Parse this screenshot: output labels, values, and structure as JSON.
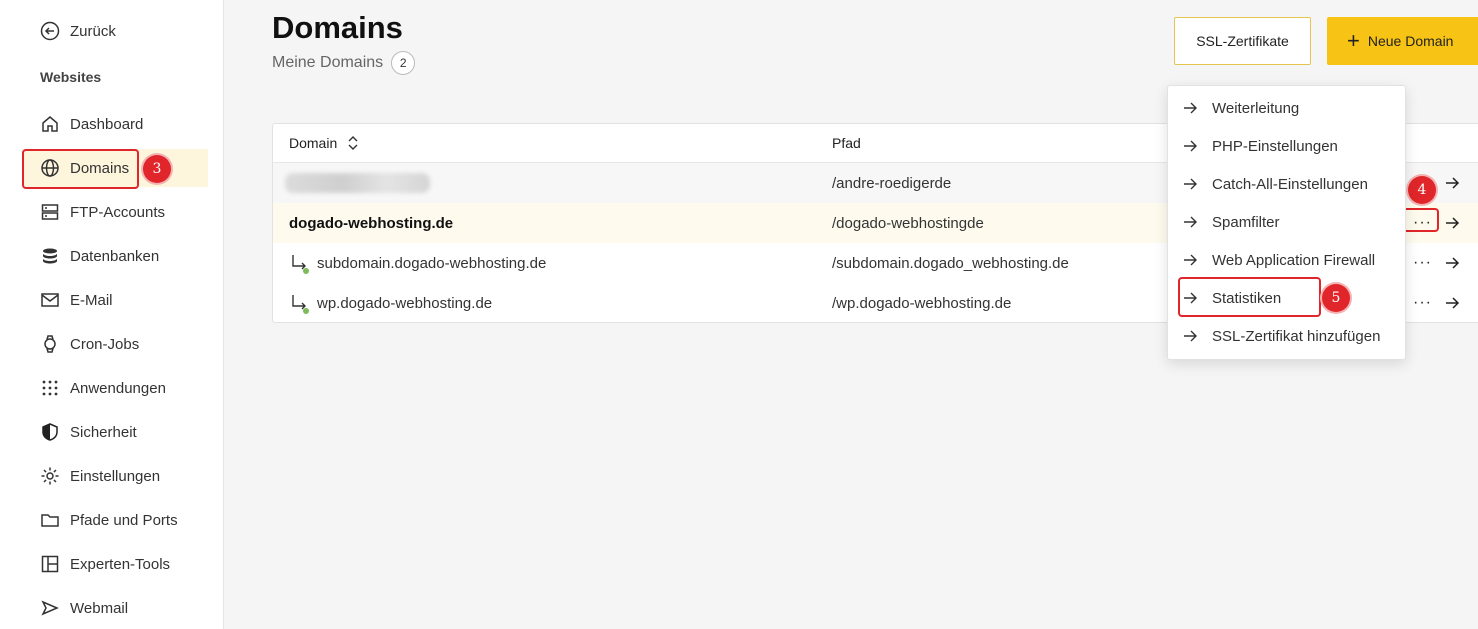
{
  "sidebar": {
    "back_label": "Zurück",
    "section_label": "Websites",
    "items": [
      {
        "label": "Dashboard",
        "icon": "home-icon"
      },
      {
        "label": "Domains",
        "icon": "globe-icon"
      },
      {
        "label": "FTP-Accounts",
        "icon": "server-icon"
      },
      {
        "label": "Datenbanken",
        "icon": "database-icon"
      },
      {
        "label": "E-Mail",
        "icon": "mail-icon"
      },
      {
        "label": "Cron-Jobs",
        "icon": "watch-icon"
      },
      {
        "label": "Anwendungen",
        "icon": "grid-dots-icon"
      },
      {
        "label": "Sicherheit",
        "icon": "shield-icon"
      },
      {
        "label": "Einstellungen",
        "icon": "gear-icon"
      },
      {
        "label": "Pfade und Ports",
        "icon": "folder-icon"
      },
      {
        "label": "Experten-Tools",
        "icon": "layout-icon"
      },
      {
        "label": "Webmail",
        "icon": "send-icon"
      }
    ],
    "active_item": "Domains"
  },
  "header": {
    "title": "Domains",
    "subtitle": "Meine Domains",
    "count": "2",
    "ssl_button": "SSL-Zertifikate",
    "new_button": "Neue Domain"
  },
  "table": {
    "columns": [
      "Domain",
      "Pfad"
    ],
    "rows": [
      {
        "domain": "",
        "path": "/andre-roedigerde",
        "redacted": true
      },
      {
        "domain": "dogado-webhosting.de",
        "path": "/dogado-webhostingde",
        "bold": true
      },
      {
        "domain": "subdomain.dogado-webhosting.de",
        "path": "/subdomain.dogado_webhosting.de",
        "sub": true
      },
      {
        "domain": "wp.dogado-webhosting.de",
        "path": "/wp.dogado-webhosting.de",
        "sub": true
      }
    ]
  },
  "menu": {
    "items": [
      "Weiterleitung",
      "PHP-Einstellungen",
      "Catch-All-Einstellungen",
      "Spamfilter",
      "Web Application Firewall",
      "Statistiken",
      "SSL-Zertifikat hinzufügen"
    ]
  },
  "annotations": {
    "step3": "3",
    "step4": "4",
    "step5": "5"
  },
  "colors": {
    "accent": "#f7c315",
    "active_bg": "#fdf6dc",
    "annotation": "#e0262a",
    "status_dot": "#7cba5a"
  }
}
